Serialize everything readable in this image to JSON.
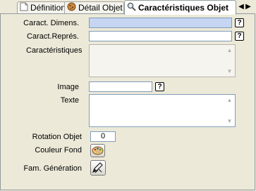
{
  "tabs": [
    {
      "label": "Définition",
      "icon": "document-icon"
    },
    {
      "label": "Détail Objet",
      "icon": "cookie-icon"
    },
    {
      "label": "Caractéristiques Objet",
      "icon": "magnifier-icon"
    }
  ],
  "tab_nav": {
    "prev": "◀",
    "next": "▶"
  },
  "form": {
    "caract_dimens_label": "Caract. Dimens.",
    "caract_dimens_value": "",
    "caract_repres_label": "Caract.Représ.",
    "caract_repres_value": "",
    "caracteristiques_label": "Caractéristiques",
    "image_label": "Image",
    "image_value": "",
    "texte_label": "Texte",
    "rotation_label": "Rotation Objet",
    "rotation_value": "0",
    "couleur_label": "Couleur Fond",
    "fam_label": "Fam. Génération",
    "help_glyph": "?"
  },
  "colors": {
    "selected_field": "#c5d5f2",
    "panel_bg": "#ece9d8"
  }
}
